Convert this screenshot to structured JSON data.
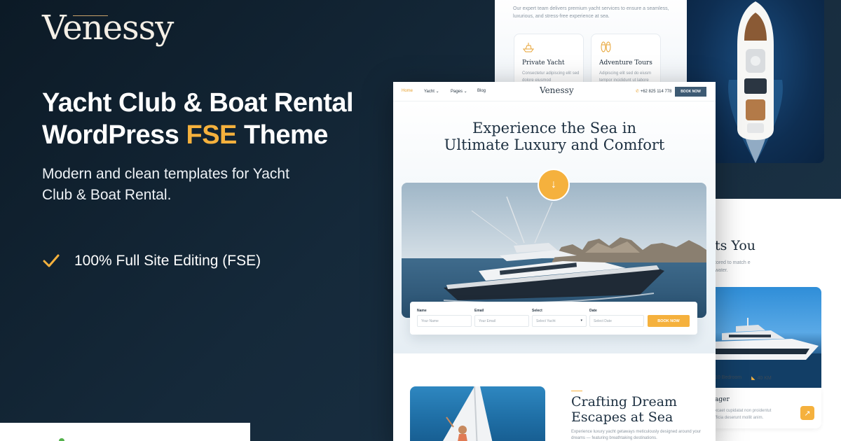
{
  "brand": {
    "logo": "Venessy"
  },
  "promo": {
    "headline_line1": "Yacht Club & Boat Rental",
    "headline_line2_pre": "WordPress ",
    "headline_accent": "FSE",
    "headline_line2_post": " Theme",
    "subline": "Modern and clean templates for Yacht Club & Boat Rental.",
    "feature": "100% Full Site Editing (FSE)"
  },
  "colors": {
    "accent": "#f5b13d",
    "navy": "#3d5a73",
    "background": "#15293a"
  },
  "services_panel": {
    "intro": "Our expert team delivers premium yacht services to ensure a seamless, luxurious, and stress-free experience at sea.",
    "cards": [
      {
        "icon": "yacht-icon",
        "title": "Private Yacht",
        "desc": "Consectetur adipiscing elit sed dolore eiusmod"
      },
      {
        "icon": "sandals-icon",
        "title": "Adventure Tours",
        "desc": "Adipiscing elit sed do eiusm tempor incididunt ut labore"
      }
    ]
  },
  "fleet_panel": {
    "heading": "ts You",
    "text": "tored to match e water.",
    "stats": [
      {
        "icon": "bed-icon",
        "label": "10 Bedroom"
      },
      {
        "icon": "speed-icon",
        "label": "40 KM"
      }
    ],
    "card_title": "ager",
    "card_desc": "xcaet cupidatat non proidentut fficia deserunt mollit anim."
  },
  "mock": {
    "nav": {
      "home": "Home",
      "yacht": "Yacht",
      "pages": "Pages",
      "blog": "Blog",
      "logo": "Venessy",
      "phone": "+62 825 114 778",
      "book": "BOOK NOW"
    },
    "hero_title_line1": "Experience the Sea in",
    "hero_title_line2": "Ultimate Luxury and Comfort",
    "form": {
      "name_label": "Name",
      "name_placeholder": "Your Name",
      "email_label": "Email",
      "email_placeholder": "Your Email",
      "select_label": "Select",
      "select_placeholder": "Select Yacht",
      "date_label": "Date",
      "date_placeholder": "Select Date",
      "submit": "BOOK NOW"
    },
    "about_title_line1": "Crafting Dream",
    "about_title_line2": "Escapes at Sea",
    "about_text": "Experience luxury yacht getaways meticulously designed around your dreams — featuring breathtaking destinations."
  }
}
